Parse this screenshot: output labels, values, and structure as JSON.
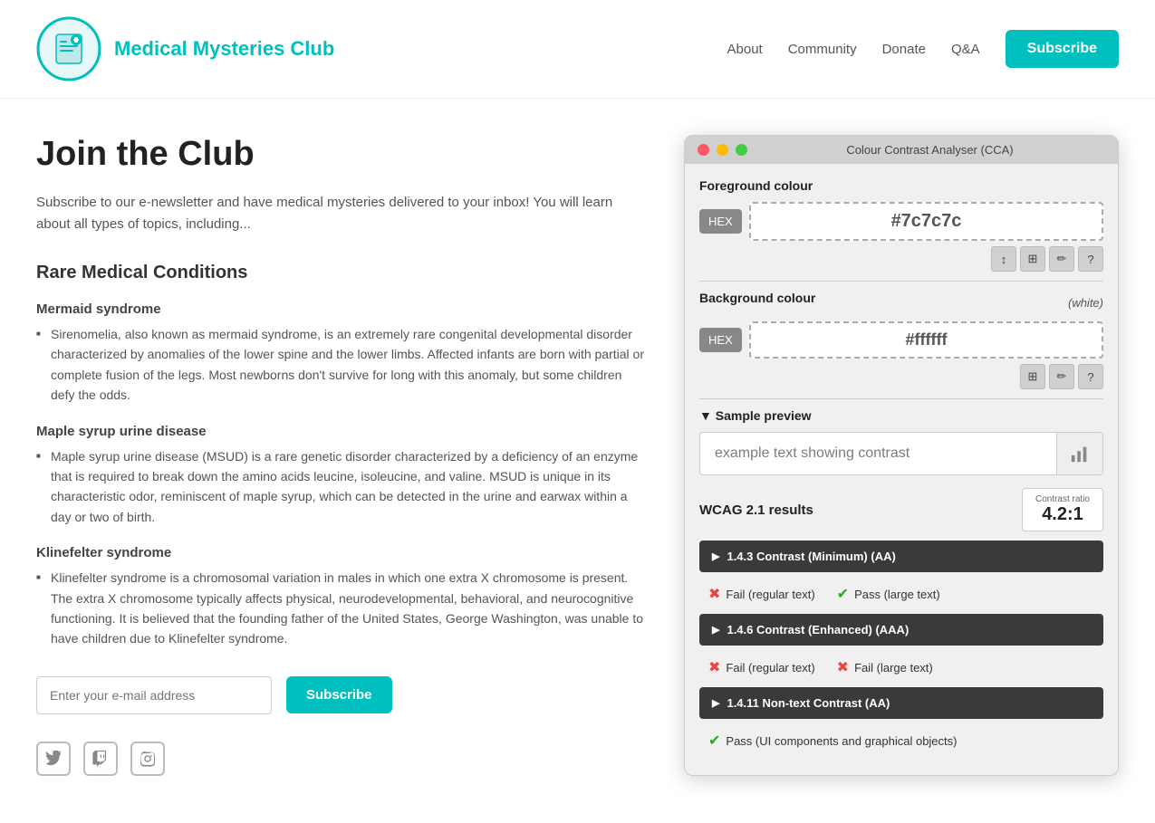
{
  "header": {
    "logo_alt": "Medical Mysteries Club logo",
    "title": "Medical Mysteries Club",
    "nav": [
      {
        "label": "About",
        "id": "about"
      },
      {
        "label": "Community",
        "id": "community"
      },
      {
        "label": "Donate",
        "id": "donate"
      },
      {
        "label": "Q&A",
        "id": "qa"
      }
    ],
    "subscribe_label": "Subscribe"
  },
  "content": {
    "page_title": "Join the Club",
    "intro": "Subscribe to our e-newsletter and have medical mysteries delivered to your inbox! You will learn about all types of topics, including...",
    "section_title": "Rare Medical Conditions",
    "conditions": [
      {
        "title": "Mermaid syndrome",
        "text": "Sirenomelia, also known as mermaid syndrome, is an extremely rare congenital developmental disorder characterized by anomalies of the lower spine and the lower limbs. Affected infants are born with partial or complete fusion of the legs. Most newborns don't survive for long with this anomaly, but some children defy the odds."
      },
      {
        "title": "Maple syrup urine disease",
        "text": "Maple syrup urine disease (MSUD) is a rare genetic disorder characterized by a deficiency of an enzyme that is required to break down the amino acids leucine, isoleucine, and valine. MSUD is unique in its characteristic odor, reminiscent of maple syrup, which can be detected in the urine and earwax within a day or two of birth."
      },
      {
        "title": "Klinefelter syndrome",
        "text": "Klinefelter syndrome is a chromosomal variation in males in which one extra X chromosome is present. The extra X chromosome typically affects physical, neurodevelopmental, behavioral, and neurocognitive functioning. It is believed that the founding father of the United States, George Washington, was unable to have children due to Klinefelter syndrome."
      }
    ],
    "email_placeholder": "Enter your e-mail address",
    "subscribe_btn": "Subscribe",
    "social_icons": [
      "twitter",
      "twitch",
      "instagram"
    ]
  },
  "cca": {
    "title": "Colour Contrast Analyser (CCA)",
    "fg_label": "Foreground colour",
    "fg_format": "HEX",
    "fg_value": "#7c7c7c",
    "bg_label": "Background colour",
    "bg_white": "(white)",
    "bg_format": "HEX",
    "bg_value": "#ffffff",
    "preview_label": "▼ Sample preview",
    "preview_text": "example text showing contrast",
    "wcag_label": "WCAG 2.1 results",
    "contrast_ratio_label": "Contrast ratio",
    "contrast_ratio": "4.2:1",
    "results": [
      {
        "label": "1.4.3 Contrast (Minimum) (AA)",
        "pass_regular": false,
        "pass_large": true,
        "fail_regular_label": "Fail (regular text)",
        "pass_large_label": "Pass (large text)"
      },
      {
        "label": "1.4.6 Contrast (Enhanced) (AAA)",
        "pass_regular": false,
        "pass_large": false,
        "fail_regular_label": "Fail (regular text)",
        "fail_large_label": "Fail (large text)"
      },
      {
        "label": "1.4.11 Non-text Contrast (AA)",
        "pass_ui": true,
        "pass_ui_label": "Pass (UI components and graphical objects)"
      }
    ]
  }
}
